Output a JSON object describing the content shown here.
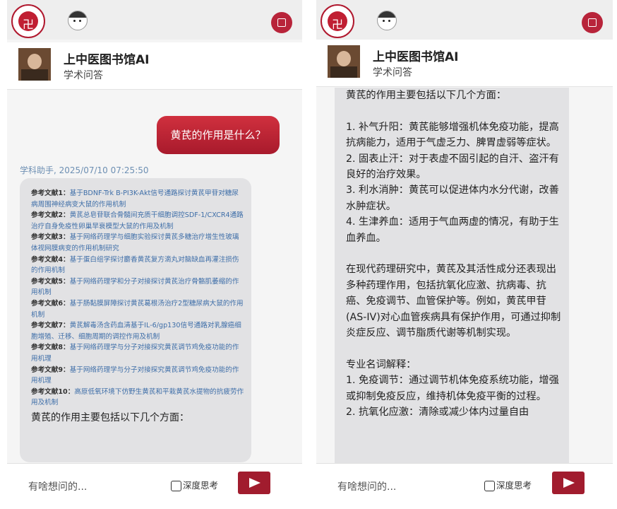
{
  "app": {
    "logo_glyph": "卍",
    "bot_name": "上中医图书馆AI",
    "bot_subtitle": "学术问答"
  },
  "left": {
    "user_message": "黄芪的作用是什么？",
    "meta": "学科助手, 2025/07/10 07:25:50",
    "references": [
      {
        "label": "参考文献1：",
        "title": "基于BDNF-Trk B-PI3K-Akt信号通路探讨黄芪甲苷对糖尿病周围神经病变大鼠的作用机制"
      },
      {
        "label": "参考文献2：",
        "title": "黄芪总皂苷联合骨髓间充质干细胞调控SDF-1/CXCR4通路治疗自身免疫性卵巢早衰模型大鼠的作用及机制"
      },
      {
        "label": "参考文献3：",
        "title": "基于网络药理学与细胞实验探讨黄芪多糖治疗增生性玻璃体视网膜病变的作用机制研究"
      },
      {
        "label": "参考文献4：",
        "title": "基于蛋白组学探讨麝香黄芪复方滴丸对脑缺血再灌注损伤的作用机制"
      },
      {
        "label": "参考文献5：",
        "title": "基于网络药理学和分子对接探讨黄芪治疗骨骼肌萎缩的作用机制"
      },
      {
        "label": "参考文献6：",
        "title": "基于肠黏膜屏障探讨黄芪葛根汤治疗2型糖尿病大鼠的作用机制"
      },
      {
        "label": "参考文献7：",
        "title": "黄芪解毒汤含药血清基于IL-6/gp130信号通路对乳腺癌细胞增殖、迁移、细胞周期的调控作用及机制"
      },
      {
        "label": "参考文献8：",
        "title": "基于网络药理学与分子对接探究黄芪调节鸡免疫功能的作用机理"
      },
      {
        "label": "参考文献9：",
        "title": "基于网络药理学与分子对接探究黄芪调节鸡免疫功能的作用机理"
      },
      {
        "label": "参考文献10：",
        "title": "高原低氧环境下仿野生黄芪和平栽黄芪水提物的抗疲劳作用及机制"
      }
    ],
    "answer_intro": "黄芪的作用主要包括以下几个方面："
  },
  "right": {
    "answer_lines": [
      "黄芪的作用主要包括以下几个方面：",
      "",
      "1. 补气升阳：黄芪能够增强机体免疫功能，提高抗病能力，适用于气虚乏力、脾胃虚弱等症状。",
      "2. 固表止汗：对于表虚不固引起的自汗、盗汗有良好的治疗效果。",
      "3. 利水消肿：黄芪可以促进体内水分代谢，改善水肿症状。",
      "4. 生津养血：适用于气血两虚的情况，有助于生血养血。",
      "",
      "在现代药理研究中，黄芪及其活性成分还表现出多种药理作用，包括抗氧化应激、抗病毒、抗癌、免疫调节、血管保护等。例如，黄芪甲苷(AS-IV)对心血管疾病具有保护作用，可通过抑制炎症反应、调节脂质代谢等机制实现。",
      "",
      "专业名词解释：",
      "1. 免疫调节：通过调节机体免疫系统功能，增强或抑制免疫反应，维持机体免疫平衡的过程。",
      "2. 抗氧化应激：清除或减少体内过量自由"
    ]
  },
  "input": {
    "placeholder": "有啥想问的...",
    "deep_think_label": "深度思考"
  },
  "colors": {
    "brand_red": "#a81a2c",
    "reference_link": "#3e6ea8",
    "card_bg": "#e2e2e4"
  }
}
